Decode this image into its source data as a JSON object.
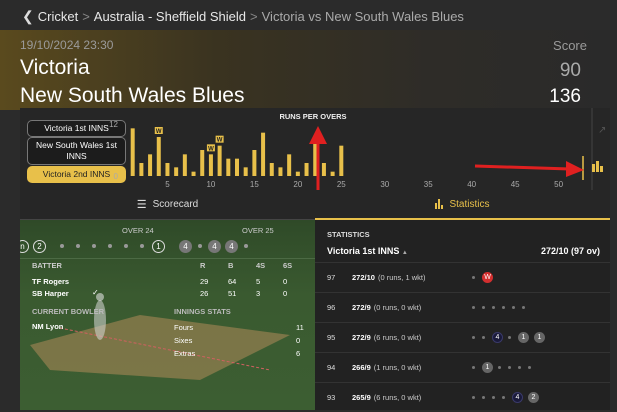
{
  "breadcrumb": {
    "back": "Cricket",
    "sep1": ">",
    "competition": "Australia - Sheffield Shield",
    "sep2": ">",
    "match": "Victoria vs New South Wales Blues"
  },
  "header": {
    "datetime": "19/10/2024 23:30",
    "score_label": "Score",
    "team1": "Victoria",
    "team1_score": "90",
    "team2": "New South Wales Blues",
    "team2_score": "136"
  },
  "innings_buttons": [
    "Victoria 1st INNS",
    "New South Wales 1st INNS",
    "Victoria 2nd INNS"
  ],
  "chart_data": {
    "type": "bar",
    "title": "RUNS PER OVERS",
    "x": [
      1,
      2,
      3,
      4,
      5,
      6,
      7,
      8,
      9,
      10,
      11,
      12,
      13,
      14,
      15,
      16,
      17,
      18,
      19,
      20,
      21,
      22,
      23,
      24,
      25
    ],
    "values": [
      11,
      3,
      5,
      9,
      3,
      2,
      5,
      1,
      6,
      5,
      7,
      4,
      4,
      2,
      6,
      10,
      3,
      2,
      5,
      1,
      3,
      8,
      3,
      1,
      7
    ],
    "wicket_overs": [
      4,
      10,
      11
    ],
    "xticks": [
      "5",
      "10",
      "15",
      "20",
      "25",
      "30",
      "35",
      "40",
      "45",
      "50"
    ],
    "yticks": [
      "12",
      "0"
    ],
    "xlim": [
      0,
      52
    ],
    "ylim": [
      0,
      12
    ],
    "bar_color": "#e8c04a"
  },
  "tabs": {
    "scorecard": "Scorecard",
    "statistics": "Statistics"
  },
  "overs": {
    "over24_label": "OVER 24",
    "over25_label": "OVER 25",
    "balls_left": [
      "n",
      "2"
    ],
    "ball24_end": "1",
    "balls25": [
      "4",
      "4",
      "4"
    ]
  },
  "batting": {
    "header": [
      "BATTER",
      "R",
      "B",
      "4S",
      "6S"
    ],
    "rows": [
      [
        "TF Rogers",
        "29",
        "64",
        "5",
        "0"
      ],
      [
        "SB Harper",
        "26",
        "51",
        "3",
        "0"
      ]
    ]
  },
  "bowler": {
    "label": "CURRENT BOWLER",
    "name": "NM Lyon"
  },
  "innings_stats": {
    "label": "INNINGS STATS",
    "rows": [
      [
        "Fours",
        "11"
      ],
      [
        "Sixes",
        "0"
      ],
      [
        "Extras",
        "6"
      ]
    ]
  },
  "stats": {
    "title": "STATISTICS",
    "innings": "Victoria 1st INNS",
    "innings_total": "272/10 (97 ov)",
    "rows": [
      {
        "over": "97",
        "score": "272/10",
        "detail": "(0 runs, 1 wkt)",
        "balls": [
          "dot",
          "W"
        ]
      },
      {
        "over": "96",
        "score": "272/9",
        "detail": "(0 runs, 0 wkt)",
        "balls": [
          "dot",
          "dot",
          "dot",
          "dot",
          "dot",
          "dot"
        ]
      },
      {
        "over": "95",
        "score": "272/9",
        "detail": "(6 runs, 0 wkt)",
        "balls": [
          "dot",
          "dot",
          "4",
          "dot",
          "1",
          "1"
        ]
      },
      {
        "over": "94",
        "score": "266/9",
        "detail": "(1 runs, 0 wkt)",
        "balls": [
          "dot",
          "1",
          "dot",
          "dot",
          "dot",
          "dot"
        ]
      },
      {
        "over": "93",
        "score": "265/9",
        "detail": "(6 runs, 0 wkt)",
        "balls": [
          "dot",
          "dot",
          "dot",
          "dot",
          "4",
          "2"
        ]
      }
    ]
  },
  "colors": {
    "accent": "#e8c04a",
    "wicket": "#d32f2f",
    "arrow": "#e02020"
  }
}
